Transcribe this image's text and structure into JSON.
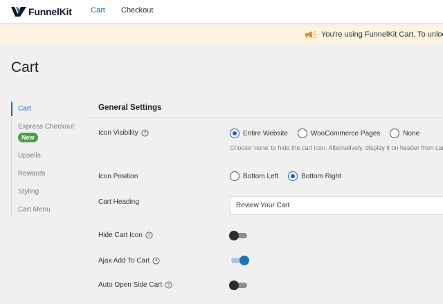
{
  "brand": {
    "name": "FunnelKit"
  },
  "nav": {
    "tabs": [
      {
        "label": "Cart"
      },
      {
        "label": "Checkout"
      }
    ],
    "active": "Cart"
  },
  "notice": {
    "text": "You're using FunnelKit Cart. To unlock mor"
  },
  "page": {
    "title": "Cart"
  },
  "sidebar": {
    "items": [
      {
        "label": "Cart"
      },
      {
        "label": "Express Checkout"
      },
      {
        "label": "Upsells"
      },
      {
        "label": "Rewards"
      },
      {
        "label": "Styling"
      },
      {
        "label": "Cart Menu"
      }
    ],
    "new_badge": "New"
  },
  "settings": {
    "section_title": "General Settings",
    "icon_visibility": {
      "label": "Icon Visibility",
      "options": [
        {
          "label": "Entire Website"
        },
        {
          "label": "WooCommerce Pages"
        },
        {
          "label": "None"
        }
      ],
      "selected": "Entire Website",
      "hint": "Choose 'none' to hide the cart icon. Alternatively, display it on header from cart"
    },
    "icon_position": {
      "label": "Icon Position",
      "options": [
        {
          "label": "Bottom Left"
        },
        {
          "label": "Bottom Right"
        }
      ],
      "selected": "Bottom Right"
    },
    "cart_heading": {
      "label": "Cart Heading",
      "value": "Review Your Cart"
    },
    "hide_cart_icon": {
      "label": "Hide Cart Icon",
      "enabled": false
    },
    "ajax_add_to_cart": {
      "label": "Ajax Add To Cart",
      "enabled": true
    },
    "auto_open_side_cart": {
      "label": "Auto Open Side Cart",
      "enabled": false
    }
  },
  "colors": {
    "accent": "#1a63c5",
    "notice_bg": "#fdf3e1",
    "badge_green": "#46a046"
  }
}
